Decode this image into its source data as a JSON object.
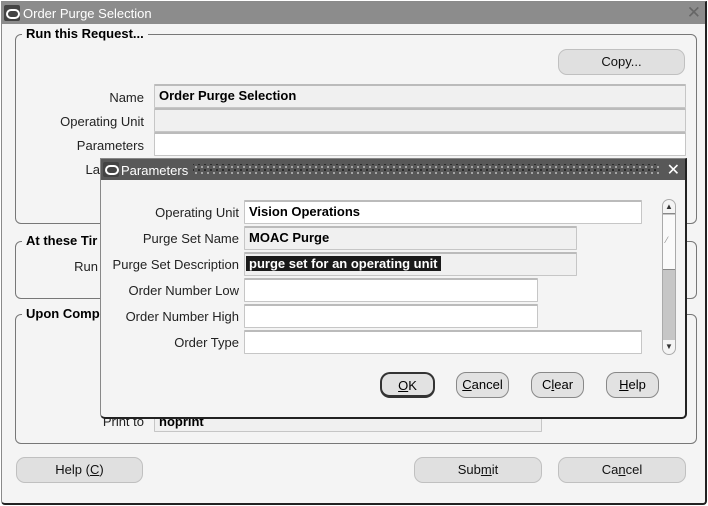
{
  "window": {
    "title": "Order Purge Selection",
    "close_label": "✕"
  },
  "run_request": {
    "legend": "Run this Request...",
    "copy_button": "Copy...",
    "fields": [
      {
        "label": "Name",
        "value": "Order Purge Selection"
      },
      {
        "label": "Operating Unit",
        "value": ""
      },
      {
        "label": "Parameters",
        "value": ""
      },
      {
        "label": "La",
        "value": ""
      }
    ]
  },
  "at_these_times": {
    "legend": "At these Tir",
    "run_label": "Run"
  },
  "upon_completion": {
    "legend": "Upon Comp",
    "print_to_label": "Print to",
    "print_to_value": "noprint"
  },
  "footer": {
    "help_prefix": "Help (",
    "help_mnemonic": "C",
    "help_suffix": ")",
    "submit_prefix": "Sub",
    "submit_mnemonic": "m",
    "submit_suffix": "it",
    "cancel_prefix": "Ca",
    "cancel_mnemonic": "n",
    "cancel_suffix": "cel"
  },
  "parameters_dialog": {
    "title": "Parameters",
    "close_label": "✕",
    "fields": [
      {
        "label": "Operating Unit",
        "value": "Vision Operations"
      },
      {
        "label": "Purge Set Name",
        "value": "MOAC Purge"
      },
      {
        "label": "Purge Set Description",
        "value": "purge set for an operating unit"
      },
      {
        "label": "Order Number Low",
        "value": ""
      },
      {
        "label": "Order Number High",
        "value": ""
      },
      {
        "label": "Order Type",
        "value": ""
      }
    ],
    "buttons": {
      "ok_mnemonic": "O",
      "ok_rest": "K",
      "cancel_mnemonic": "C",
      "cancel_rest": "ancel",
      "clear_pre": "C",
      "clear_mnemonic": "l",
      "clear_rest": "ear",
      "help_mnemonic": "H",
      "help_rest": "elp"
    },
    "scroll_up_icon": "▲",
    "scroll_down_icon": "▼"
  }
}
